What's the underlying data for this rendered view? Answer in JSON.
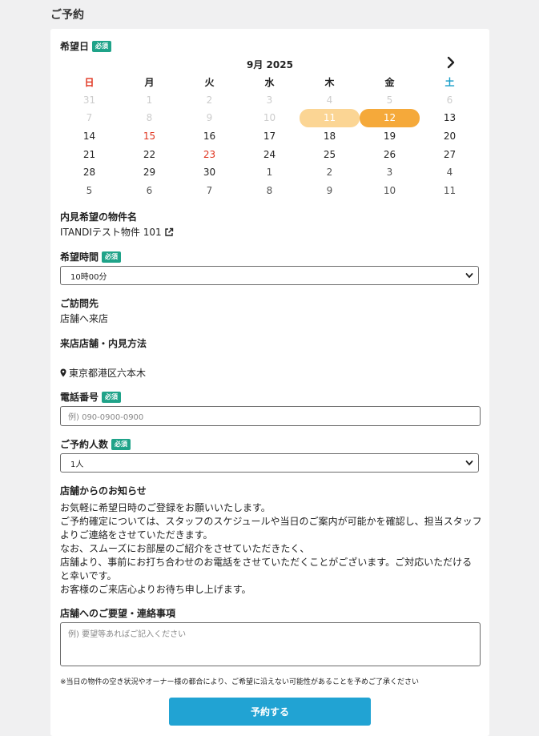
{
  "page_title": "ご予約",
  "required_badge": "必須",
  "desired_date": {
    "label": "希望日",
    "month_label": "9月 2025",
    "next_icon": "chevron-right-icon",
    "weekdays": [
      "日",
      "月",
      "火",
      "水",
      "木",
      "金",
      "土"
    ],
    "weeks": [
      [
        "31",
        "1",
        "2",
        "3",
        "4",
        "5",
        "6"
      ],
      [
        "7",
        "8",
        "9",
        "10",
        "11",
        "12",
        "13"
      ],
      [
        "14",
        "15",
        "16",
        "17",
        "18",
        "19",
        "20"
      ],
      [
        "21",
        "22",
        "23",
        "24",
        "25",
        "26",
        "27"
      ],
      [
        "28",
        "29",
        "30",
        "1",
        "2",
        "3",
        "4"
      ],
      [
        "5",
        "6",
        "7",
        "8",
        "9",
        "10",
        "11"
      ]
    ],
    "highlighted_day": "11",
    "selected_day": "12",
    "holidays": [
      "15",
      "23"
    ]
  },
  "property": {
    "label": "内見希望の物件名",
    "name": "ITANDIテスト物件 101",
    "link_icon": "external-link-icon"
  },
  "desired_time": {
    "label": "希望時間",
    "value": "10時00分"
  },
  "visit_destination": {
    "label": "ご訪問先",
    "value": "店舗へ来店"
  },
  "store": {
    "label": "来店店舗・内見方法",
    "address": "東京都港区六本木",
    "pin_icon": "map-pin-icon"
  },
  "phone": {
    "label": "電話番号",
    "placeholder": "例) 090-0900-0900"
  },
  "party_size": {
    "label": "ご予約人数",
    "value": "1人"
  },
  "store_notice": {
    "label": "店舗からのお知らせ",
    "lines": [
      "お気軽に希望日時のご登録をお願いいたします。",
      "ご予約確定については、スタッフのスケジュールや当日のご案内が可能かを確認し、担当スタッフ",
      "よりご連絡をさせていただきます。",
      "なお、スムーズにお部屋のご紹介をさせていただきたく、",
      "店舗より、事前にお打ち合わせのお電話をさせていただくことがございます。ご対応いただける",
      "と幸いです。",
      "お客様のご来店心よりお待ち申し上げます。"
    ]
  },
  "requests": {
    "label": "店舗へのご要望・連絡事項",
    "placeholder": "例) 要望等あればご記入ください"
  },
  "disclaimer": "※当日の物件の空き状況やオーナー様の都合により、ご希望に沿えない可能性があることを予めご了承ください",
  "submit_label": "予約する",
  "colors": {
    "badge": "#1fa389",
    "sunday": "#e0341f",
    "saturday": "#1a9ec9",
    "muted_day": "#cccccc",
    "selected_bg": "#f5a93a",
    "highlight_bg": "#fbd594",
    "submit_bg": "#21a3d3"
  }
}
